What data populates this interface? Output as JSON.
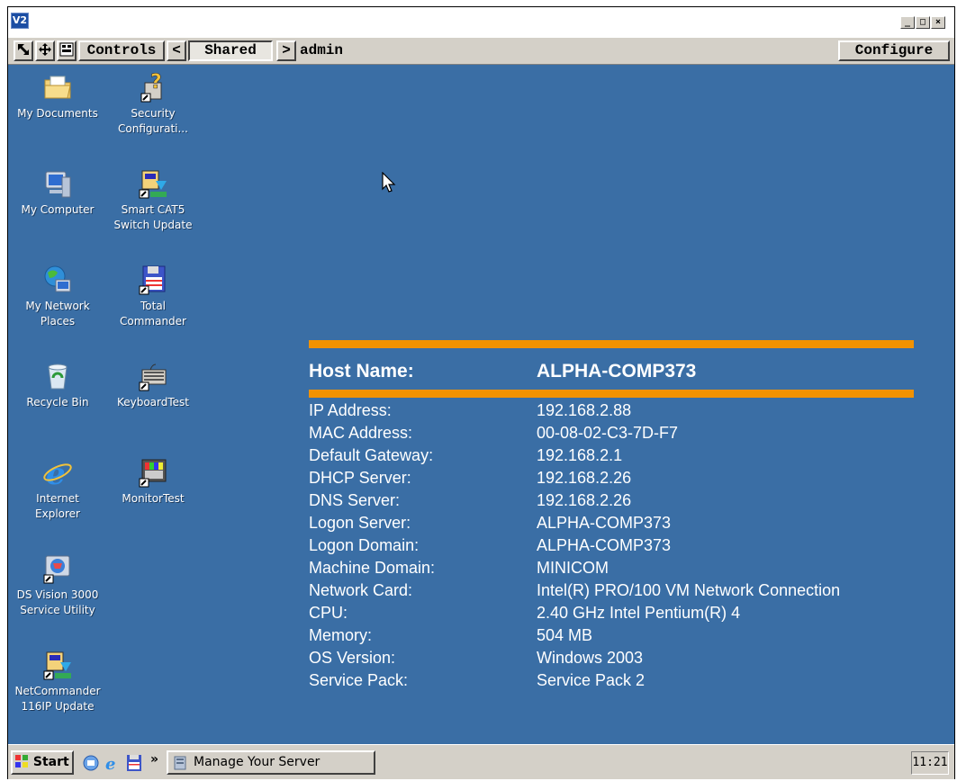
{
  "window": {
    "app_icon_text": "V2",
    "controls": {
      "minimize": "_",
      "restore": "□",
      "close": "×"
    }
  },
  "toolbar": {
    "controls_label": "Controls",
    "prev_label": "<",
    "shared_label": "Shared",
    "next_label": ">",
    "user": "admin",
    "configure_label": "Configure"
  },
  "desktop": {
    "icons": [
      {
        "label": "My Documents",
        "icon": "folder-documents-icon"
      },
      {
        "label": "Security\nConfigurati...",
        "icon": "security-config-icon"
      },
      {
        "label": "My Computer",
        "icon": "computer-icon"
      },
      {
        "label": "Smart CAT5\nSwitch Update",
        "icon": "update-shortcut-icon"
      },
      {
        "label": "My Network\nPlaces",
        "icon": "network-places-icon"
      },
      {
        "label": "Total\nCommander",
        "icon": "floppy-shortcut-icon"
      },
      {
        "label": "Recycle Bin",
        "icon": "recycle-bin-icon"
      },
      {
        "label": "KeyboardTest",
        "icon": "keyboard-shortcut-icon"
      },
      {
        "label": "Internet\nExplorer",
        "icon": "internet-explorer-icon"
      },
      {
        "label": "MonitorTest",
        "icon": "monitor-test-icon"
      },
      {
        "label": "DS Vision 3000\nService Utility",
        "icon": "service-utility-icon"
      },
      {
        "label": "NetCommander\n116IP Update",
        "icon": "update-shortcut-icon"
      }
    ]
  },
  "bginfo": {
    "host_label": "Host Name:",
    "host_value": "ALPHA-COMP373",
    "rows": [
      {
        "key": "IP Address:",
        "value": "192.168.2.88"
      },
      {
        "key": "MAC Address:",
        "value": "00-08-02-C3-7D-F7"
      },
      {
        "key": "Default Gateway:",
        "value": "192.168.2.1"
      },
      {
        "key": "DHCP Server:",
        "value": "192.168.2.26"
      },
      {
        "key": "DNS Server:",
        "value": "192.168.2.26"
      },
      {
        "key": "Logon Server:",
        "value": "ALPHA-COMP373"
      },
      {
        "key": "Logon Domain:",
        "value": "ALPHA-COMP373"
      },
      {
        "key": "Machine Domain:",
        "value": "MINICOM"
      },
      {
        "key": "Network Card:",
        "value": "Intel(R) PRO/100 VM Network Connection"
      },
      {
        "key": "CPU:",
        "value": "2.40 GHz Intel Pentium(R) 4"
      },
      {
        "key": "Memory:",
        "value": "504 MB"
      },
      {
        "key": "OS Version:",
        "value": "Windows 2003"
      },
      {
        "key": "Service Pack:",
        "value": "Service Pack 2"
      }
    ]
  },
  "taskbar": {
    "start_label": "Start",
    "chevron": "»",
    "task_label": "Manage Your Server",
    "clock": "11:21"
  },
  "colors": {
    "desktop_bg": "#3a6ea5",
    "accent_bar": "#f29200",
    "chrome": "#d4d0c8"
  }
}
